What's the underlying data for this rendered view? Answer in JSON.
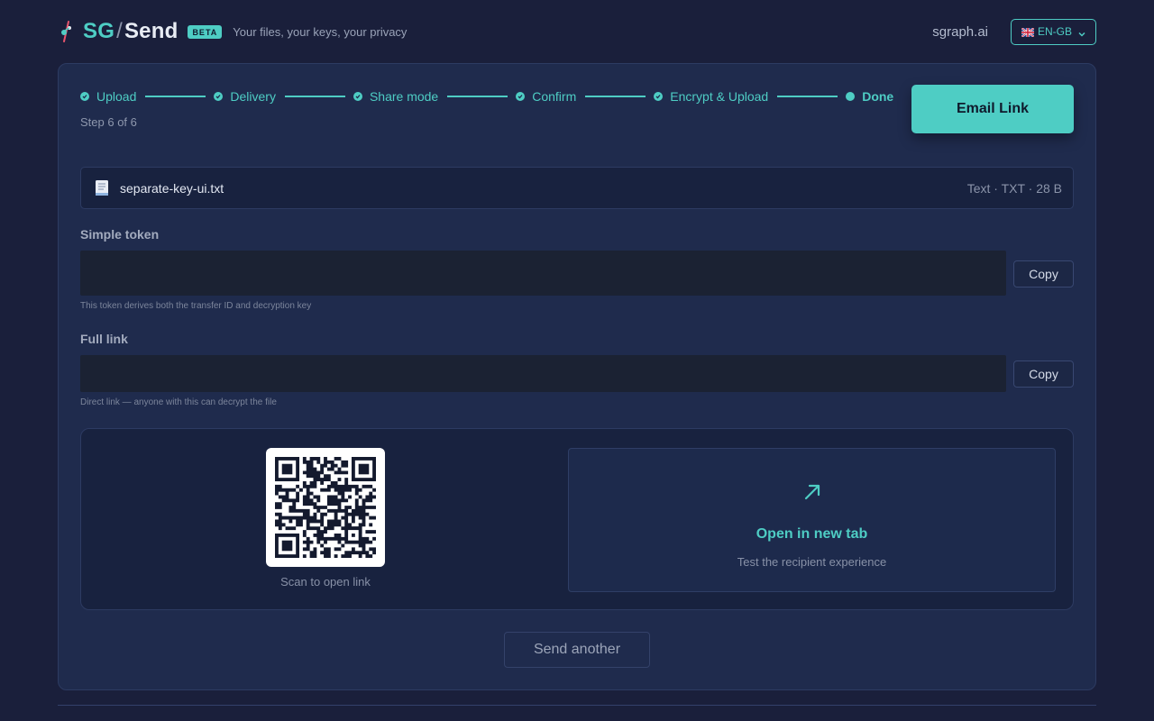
{
  "header": {
    "brand_sg": "SG",
    "brand_slash": "/",
    "brand_send": "Send",
    "badge": "BETA",
    "tagline": "Your files, your keys, your privacy",
    "site_link": "sgraph.ai",
    "language": "EN-GB"
  },
  "stepper": {
    "steps": [
      {
        "label": "Upload",
        "state": "complete"
      },
      {
        "label": "Delivery",
        "state": "complete"
      },
      {
        "label": "Share mode",
        "state": "complete"
      },
      {
        "label": "Confirm",
        "state": "complete"
      },
      {
        "label": "Encrypt & Upload",
        "state": "complete"
      },
      {
        "label": "Done",
        "state": "current"
      }
    ],
    "count": "Step 6 of 6"
  },
  "actions": {
    "email_link": "Email Link",
    "send_another": "Send another"
  },
  "file": {
    "name": "separate-key-ui.txt",
    "meta": "Text · TXT · 28 B"
  },
  "simple_token": {
    "label": "Simple token",
    "value": "",
    "copy": "Copy",
    "hint": "This token derives both the transfer ID and decryption key"
  },
  "full_link": {
    "label": "Full link",
    "value": "",
    "copy": "Copy",
    "hint": "Direct link — anyone with this can decrypt the file"
  },
  "qr": {
    "caption": "Scan to open link"
  },
  "open_tab": {
    "title": "Open in new tab",
    "subtitle": "Test the recipient experience"
  },
  "colors": {
    "accent": "#4ecdc4",
    "background": "#1a1f3b",
    "card": "#1f2b4d"
  },
  "icons": {
    "logo": "sgraph-logo-icon",
    "flag": "uk-flag-icon",
    "dropdown": "chevron-down-icon",
    "step_done": "check-circle-icon",
    "file": "document-icon",
    "open": "arrow-up-right-icon"
  }
}
